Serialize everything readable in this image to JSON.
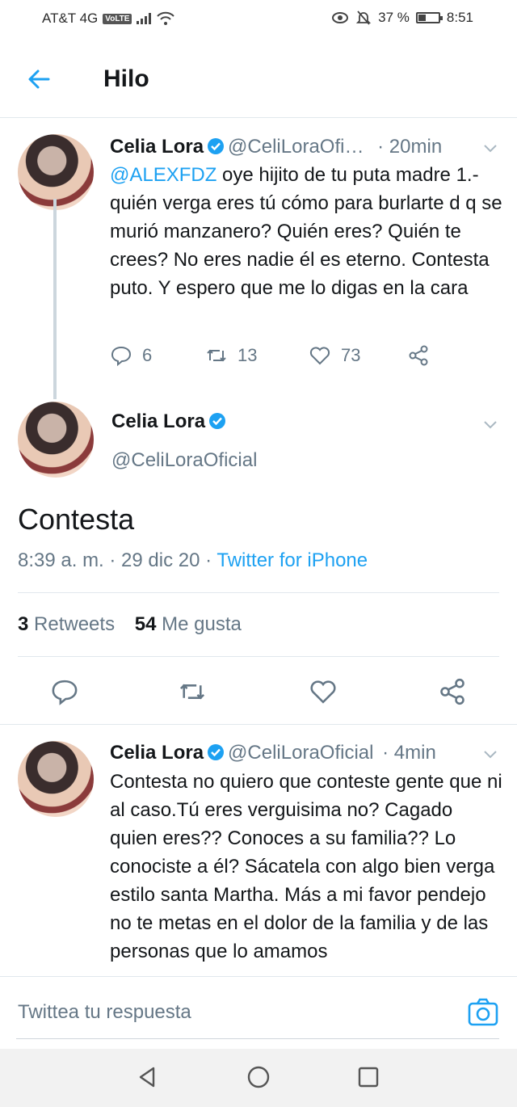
{
  "status_bar": {
    "carrier": "AT&T 4G",
    "volte_badge": "VoLTE",
    "battery_percent": "37 %",
    "battery_level": 0.37,
    "time": "8:51"
  },
  "header": {
    "title": "Hilo",
    "back_icon": "arrow-left-icon"
  },
  "tweets": [
    {
      "name": "Celia Lora",
      "handle": "@CeliLoraOfi…",
      "time": "· 20min",
      "mention": "@ALEXFDZ",
      "text": " oye hijito de tu puta madre 1.-quién verga eres tú cómo para burlarte d q se murió manzanero? Quién eres? Quién te crees? No eres nadie él es eterno. Contesta puto. Y espero que me lo digas en la cara",
      "replies": "6",
      "retweets": "13",
      "likes": "73"
    },
    {
      "name": "Celia Lora",
      "handle": "@CeliLoraOficial",
      "time": "· 4min",
      "text": "Contesta no quiero que conteste gente que ni al caso.Tú eres verguisima no? Cagado quien eres?? Conoces a su familia?? Lo conociste a él? Sácatela con algo bien verga estilo santa Martha. Más a mi favor pendejo no te metas en el dolor de la familia y de las personas que lo amamos"
    }
  ],
  "main_tweet": {
    "name": "Celia Lora",
    "handle": "@CeliLoraOficial",
    "text": "Contesta",
    "timestamp": "8:39 a. m. · 29 dic 20 · ",
    "source": "Twitter for iPhone",
    "retweet_count": "3",
    "retweet_label": " Retweets",
    "like_count": "54",
    "like_label": " Me gusta"
  },
  "reply_bar": {
    "placeholder": "Twittea tu respuesta",
    "icon": "camera-icon"
  },
  "colors": {
    "accent": "#1da1f2",
    "secondary_text": "#657786",
    "divider": "#e1e8ed"
  }
}
